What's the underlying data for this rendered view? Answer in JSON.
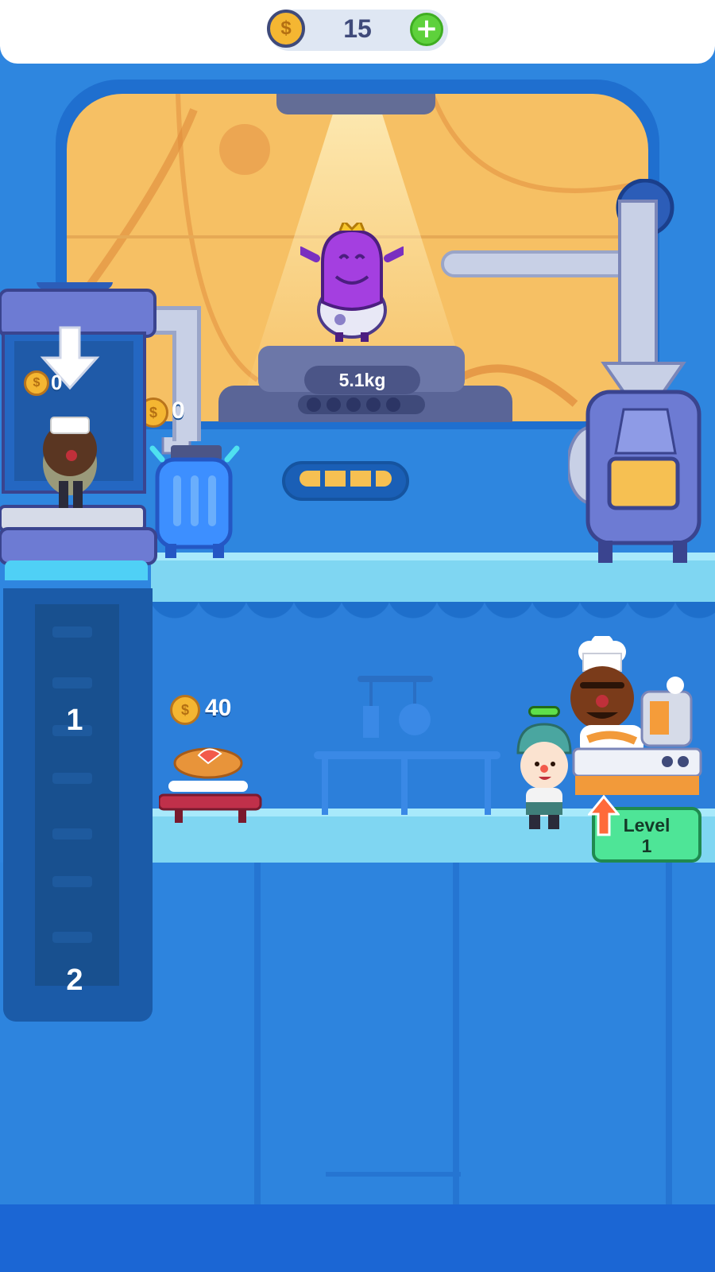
{
  "hud": {
    "coin_symbol": "$",
    "coins": "15",
    "add_symbol": "+"
  },
  "factory": {
    "weight": "5.1kg",
    "tank_coins": "0",
    "elevator_coins": "0"
  },
  "shaft": {
    "floor_1": "1",
    "floor_2": "2"
  },
  "kitchen": {
    "pie_coins": "40",
    "level_button": {
      "label": "Level",
      "value": "1"
    }
  },
  "colors": {
    "accent_green": "#4ee597",
    "coin_gold": "#f4b632",
    "wall_blue": "#2e86df",
    "monster_purple": "#a43fe0"
  }
}
